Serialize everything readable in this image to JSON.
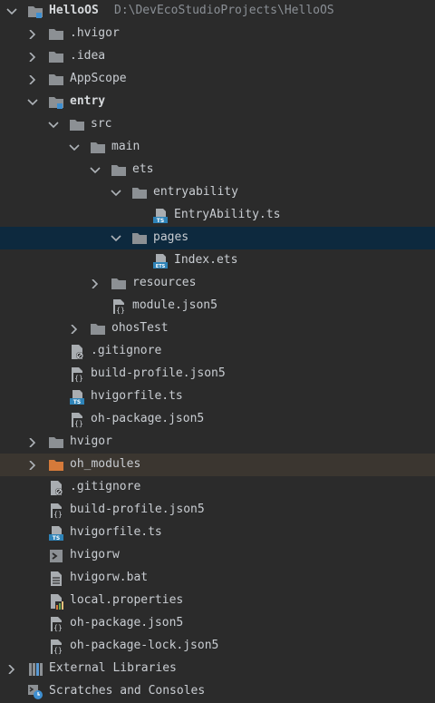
{
  "project": {
    "name": "HelloOS",
    "path": "D:\\DevEcoStudioProjects\\HelloOS"
  },
  "tree": {
    "hvigor_hidden": ".hvigor",
    "idea": ".idea",
    "appscope": "AppScope",
    "entry": "entry",
    "src": "src",
    "main": "main",
    "ets": "ets",
    "entryability": "entryability",
    "entryability_file": "EntryAbility.ts",
    "pages": "pages",
    "index_file": "Index.ets",
    "resources": "resources",
    "module_json": "module.json5",
    "ohostest": "ohosTest",
    "entry_gitignore": ".gitignore",
    "entry_build_profile": "build-profile.json5",
    "entry_hvigorfile": "hvigorfile.ts",
    "entry_oh_package": "oh-package.json5",
    "hvigor": "hvigor",
    "oh_modules": "oh_modules",
    "root_gitignore": ".gitignore",
    "root_build_profile": "build-profile.json5",
    "root_hvigorfile": "hvigorfile.ts",
    "hvigorw": "hvigorw",
    "hvigorw_bat": "hvigorw.bat",
    "local_properties": "local.properties",
    "root_oh_package": "oh-package.json5",
    "oh_package_lock": "oh-package-lock.json5",
    "external_libraries": "External Libraries",
    "scratches": "Scratches and Consoles"
  },
  "colors": {
    "background": "#2b2b2b",
    "selected_row": "#0d293e",
    "excluded_row": "#3b3630",
    "folder": "#8c9094",
    "excluded_folder": "#d57a3a",
    "ts_badge": "#2e83b8"
  }
}
